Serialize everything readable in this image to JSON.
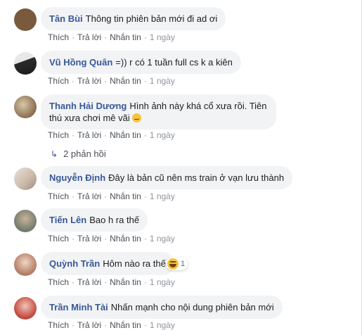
{
  "actions": {
    "like": "Thích",
    "reply": "Trả lời",
    "message": "Nhắn tin",
    "separator": "·"
  },
  "comments": [
    {
      "author": "Tân Bùi",
      "text": "Thông tin phiên bản mới đi ad ơi",
      "time": "1 ngày",
      "avatar_color": "#7a5a3c"
    },
    {
      "author": "Vũ Hồng Quân",
      "text": "=)) r có 1 tuần full cs k a kiên",
      "time": "1 ngày",
      "avatar_color": "#2b2b2b"
    },
    {
      "author": "Thanh Hải Dương",
      "text": "Hình ảnh này khá cổ xưa rồi. Tiên thú xưa chơi mê vãi",
      "time": "1 ngày",
      "avatar_color": "#8a6d4f",
      "emoji": "unamused-face-icon"
    },
    {
      "author": "Nguyễn Định",
      "text": "Đây là bản cũ nên ms train ở vạn lưu thành",
      "time": "1 ngày",
      "avatar_color": "#c9b8a8"
    },
    {
      "author": "Tiến Lên",
      "text": "Bao h ra thế",
      "time": "1 ngày",
      "avatar_color": "#6f7a6a"
    },
    {
      "author": "Quỳnh Trần",
      "text": "Hôm nào ra thế",
      "time": "1 ngày",
      "avatar_color": "#b07a62",
      "reaction_count": "1"
    },
    {
      "author": "Trần Minh Tài",
      "text": "Nhấn mạnh cho nội dung phiên bản mới",
      "time": "1 ngày",
      "avatar_color": "#c0443a"
    }
  ],
  "replies": {
    "label": "2 phản hồi"
  },
  "colors": {
    "author": "#385898",
    "bubble": "#f2f3f5",
    "action": "#4b4f56",
    "meta": "#90949c"
  }
}
